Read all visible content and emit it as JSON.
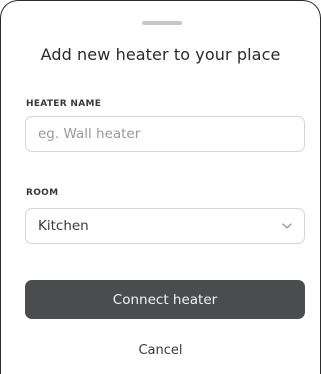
{
  "sheet": {
    "title": "Add new heater to your place"
  },
  "heater_name": {
    "label": "HEATER NAME",
    "placeholder": "eg. Wall heater"
  },
  "room": {
    "label": "ROOM",
    "selected": "Kitchen"
  },
  "actions": {
    "connect_label": "Connect heater",
    "cancel_label": "Cancel"
  },
  "icons": {
    "room_select": "chevron-down-icon"
  },
  "colors": {
    "primary_button": "#4a4c4e",
    "primary_button_text": "#f2f2f2",
    "input_border": "#d6d6d6",
    "placeholder": "#9a9a9a"
  }
}
